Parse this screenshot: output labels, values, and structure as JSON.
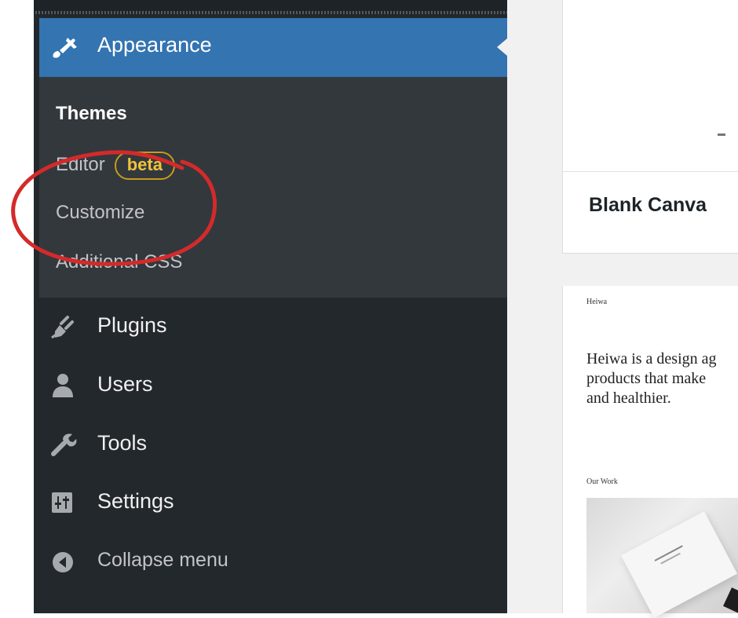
{
  "sidebar": {
    "active_menu": {
      "label": "Appearance",
      "icon": "paintbrush-icon"
    },
    "submenu": [
      {
        "label": "Themes",
        "current": true
      },
      {
        "label": "Editor",
        "badge": "beta"
      },
      {
        "label": "Customize"
      },
      {
        "label": "Additional CSS"
      }
    ],
    "menu": [
      {
        "label": "Plugins",
        "icon": "plugin-icon"
      },
      {
        "label": "Users",
        "icon": "users-icon"
      },
      {
        "label": "Tools",
        "icon": "wrench-icon"
      },
      {
        "label": "Settings",
        "icon": "settings-icon"
      }
    ],
    "collapse": {
      "label": "Collapse menu",
      "icon": "collapse-arrow-icon"
    }
  },
  "themes": [
    {
      "name": "Blank Canva"
    },
    {
      "site_title": "Heiwa",
      "blurb_lines": [
        "Heiwa is a design ag",
        "products that make",
        "and healthier."
      ],
      "section_label": "Our Work"
    }
  ],
  "colors": {
    "sidebar_bg": "#23282d",
    "submenu_bg": "#33383d",
    "active_bg": "#3374b1",
    "badge_color": "#f0c33c",
    "annotation_red": "#d42a2a"
  }
}
